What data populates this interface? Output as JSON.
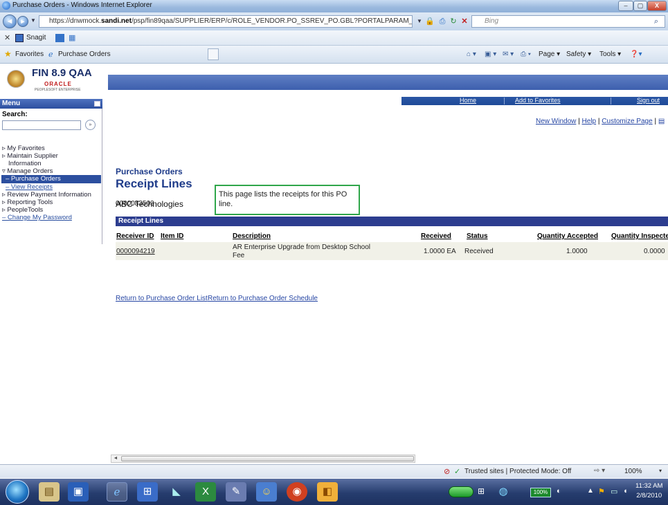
{
  "window": {
    "title": "Purchase Orders - Windows Internet Explorer",
    "controls": [
      "–",
      "▢",
      "X"
    ]
  },
  "browser": {
    "url_prefix": "https://dnwmock.",
    "url_domain": "sandi.net",
    "url_rest": "/psp/fin89qaa/SUPPLIER/ERP/c/ROLE_VENDOR.PO_SSREV_PO.GBL?PORTALPARAM_PTCNAV=EP_WV_ORDER&EO",
    "search_placeholder": "Bing",
    "toolbar_snagit": "Snagit",
    "favorites_label": "Favorites",
    "tab_label": "Purchase Orders",
    "cmd_page": "Page ▾",
    "cmd_safety": "Safety ▾",
    "cmd_tools": "Tools ▾"
  },
  "ps_header": {
    "env_title": "FIN 8.9 QAA",
    "oracle": "ORACLE",
    "peoplesoft": "PEOPLESOFT ENTERPRISE",
    "nav_home": "Home",
    "nav_favorites": "Add to Favorites",
    "nav_signout": "Sign out"
  },
  "menu": {
    "title": "Menu",
    "search_label": "Search:",
    "items": [
      "My Favorites",
      "Maintain Supplier",
      "Information",
      "Manage Orders",
      "– Purchase Orders",
      "– View Receipts",
      "Review Payment Information",
      "Reporting Tools",
      "PeopleTools",
      "– Change My Password"
    ]
  },
  "page_links": {
    "new_window": "New Window",
    "help": "Help",
    "customize": "Customize Page"
  },
  "content": {
    "breadcrumb": "Purchase Orders",
    "page_title": "Receipt Lines",
    "supplier": "ABC Technologies",
    "po_number": "0000083503",
    "tip": "This page lists the receipts for this PO line."
  },
  "grid": {
    "title": "Receipt Lines",
    "columns": [
      "Receiver ID",
      "Item ID",
      "Description",
      "Received",
      "Status",
      "Quantity Accepted",
      "Quantity Inspected"
    ],
    "rows": [
      {
        "receiver_id": "0000094219",
        "item_id": "",
        "description_1": "AR Enterprise Upgrade from Desktop School",
        "description_2": "Fee",
        "received": "1.0000 EA",
        "status": "Received",
        "qty_accepted": "1.0000",
        "qty_inspected": "0.0000"
      }
    ]
  },
  "return_links": {
    "po_list": "Return to Purchase Order List",
    "po_schedule": "Return to Purchase Order Schedule"
  },
  "statusbar": {
    "zone": "Trusted sites | Protected Mode: Off",
    "zoom": "100%"
  },
  "taskbar": {
    "battery": "100%",
    "time": "11:32 AM",
    "date": "2/8/2010"
  }
}
